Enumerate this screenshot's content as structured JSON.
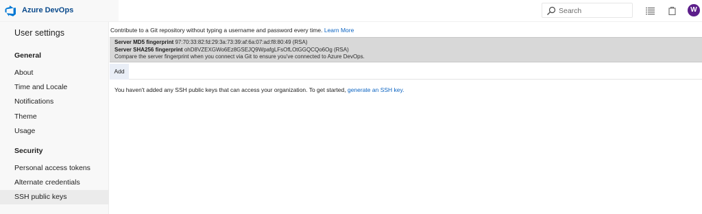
{
  "header": {
    "brand": "Azure DevOps",
    "search_placeholder": "Search",
    "avatar_initial": "W",
    "brand_color": "#0078d4",
    "avatar_color": "#5c1e8a"
  },
  "sidebar": {
    "title": "User settings",
    "sections": [
      {
        "label": "General",
        "items": [
          {
            "label": "About"
          },
          {
            "label": "Time and Locale"
          },
          {
            "label": "Notifications"
          },
          {
            "label": "Theme"
          },
          {
            "label": "Usage"
          }
        ]
      },
      {
        "label": "Security",
        "items": [
          {
            "label": "Personal access tokens"
          },
          {
            "label": "Alternate credentials"
          },
          {
            "label": "SSH public keys",
            "selected": true
          }
        ]
      }
    ]
  },
  "main": {
    "intro_text": "Contribute to a Git repository without typing a username and password every time.",
    "intro_link": "Learn More",
    "fingerprints": {
      "md5_label": "Server MD5 fingerprint",
      "md5_value": "97:70:33:82:fd:29:3a:73:39:af:6a:07:ad:f8:80:49 (RSA)",
      "sha256_label": "Server SHA256 fingerprint",
      "sha256_value": "ohD8VZEXGWo6Ez8GSEJQ9WpafgLFsOfLOtGGQCQo6Og (RSA)",
      "note": "Compare the server fingerprint when you connect via Git to ensure you've connected to Azure DevOps."
    },
    "add_button": "Add",
    "empty_text": "You haven't added any SSH public keys that can access your organization. To get started,",
    "empty_link": "generate an SSH key."
  }
}
